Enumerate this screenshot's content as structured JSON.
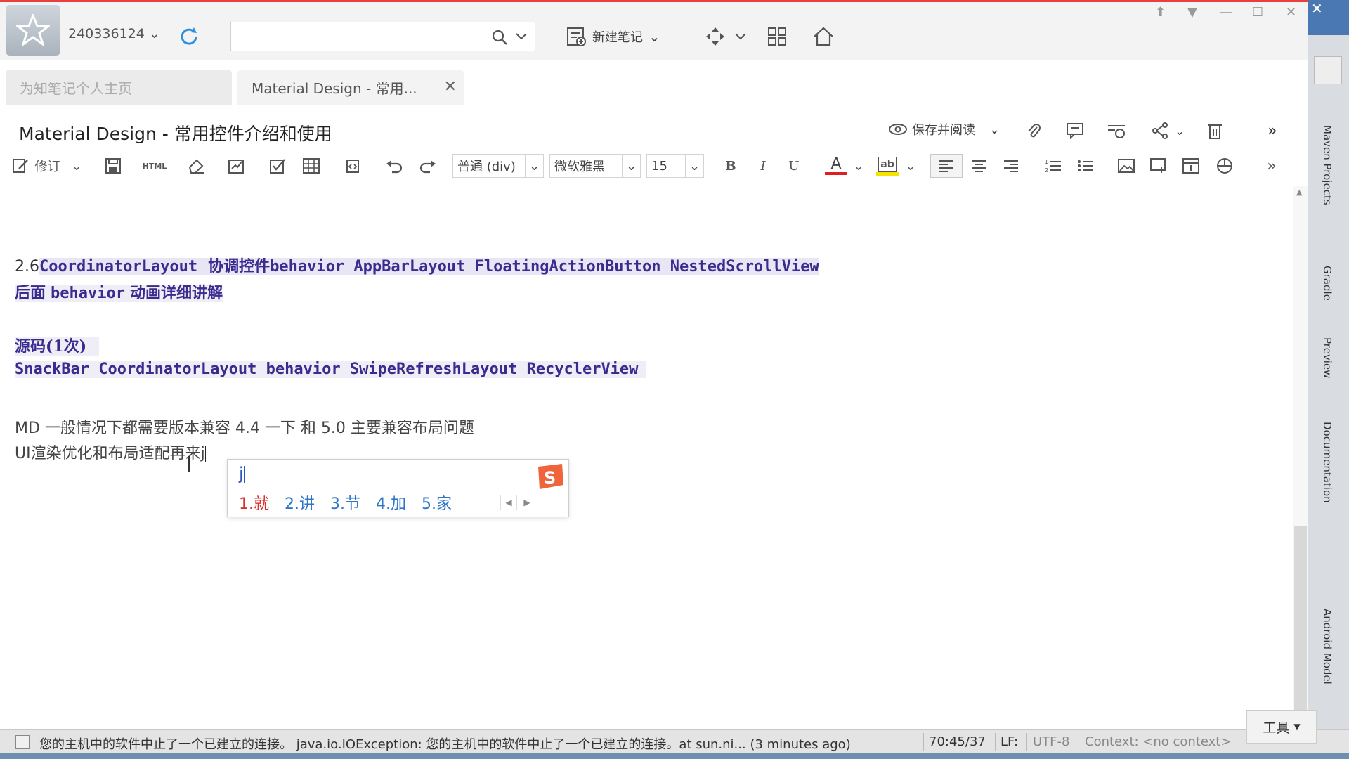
{
  "topbar": {
    "account": "240336124",
    "search_placeholder": "",
    "new_note_label": "新建笔记"
  },
  "tabs": [
    {
      "label": "为知笔记个人主页"
    },
    {
      "label": "Material Design - 常用..."
    }
  ],
  "document": {
    "title": "Material Design - 常用控件介绍和使用",
    "save_read_label": "保存并阅读"
  },
  "format_toolbar": {
    "revise_label": "修订",
    "html_label": "HTML",
    "paragraph_style": "普通 (div)",
    "font_family": "微软雅黑",
    "font_size": "15",
    "bold": "B",
    "italic": "I",
    "underline": "U",
    "font_color_glyph": "A",
    "font_color": "#e02020",
    "highlight_glyph": "ab",
    "highlight_color": "#f5e400"
  },
  "content": {
    "l1_prefix": "2.6",
    "l1_a": "CoordinatorLayout",
    "l1_b": "协调控件",
    "l1_c": "behavior  AppBarLayout FloatingActionButton NestedScrollView",
    "l2_a": "后面",
    "l2_b": "behavior",
    "l2_c": "动画详细讲解",
    "l3": "源码(1次)",
    "l4": "SnackBar  CoordinatorLayout  behavior  SwipeRefreshLayout RecyclerView",
    "l5": "MD 一般情况下都需要版本兼容  4.4 一下 和 5.0 主要兼容布局问题",
    "l6": "UI渲染优化和布局适配再来j"
  },
  "ime": {
    "input": "j",
    "candidates": [
      "1.就",
      "2.讲",
      "3.节",
      "4.加",
      "5.家"
    ]
  },
  "right_panel": {
    "tabs": [
      "Maven Projects",
      "Gradle",
      "Preview",
      "Documentation",
      "Android Model"
    ]
  },
  "statusbar": {
    "message": "您的主机中的软件中止了一个已建立的连接。 java.io.IOException: 您的主机中的软件中止了一个已建立的连接。at sun.ni... (3 minutes ago)",
    "position": "70:45/37",
    "line_ending": "LF:",
    "encoding": "UTF-8",
    "context": "Context: <no context>",
    "tools_label": "工具"
  }
}
